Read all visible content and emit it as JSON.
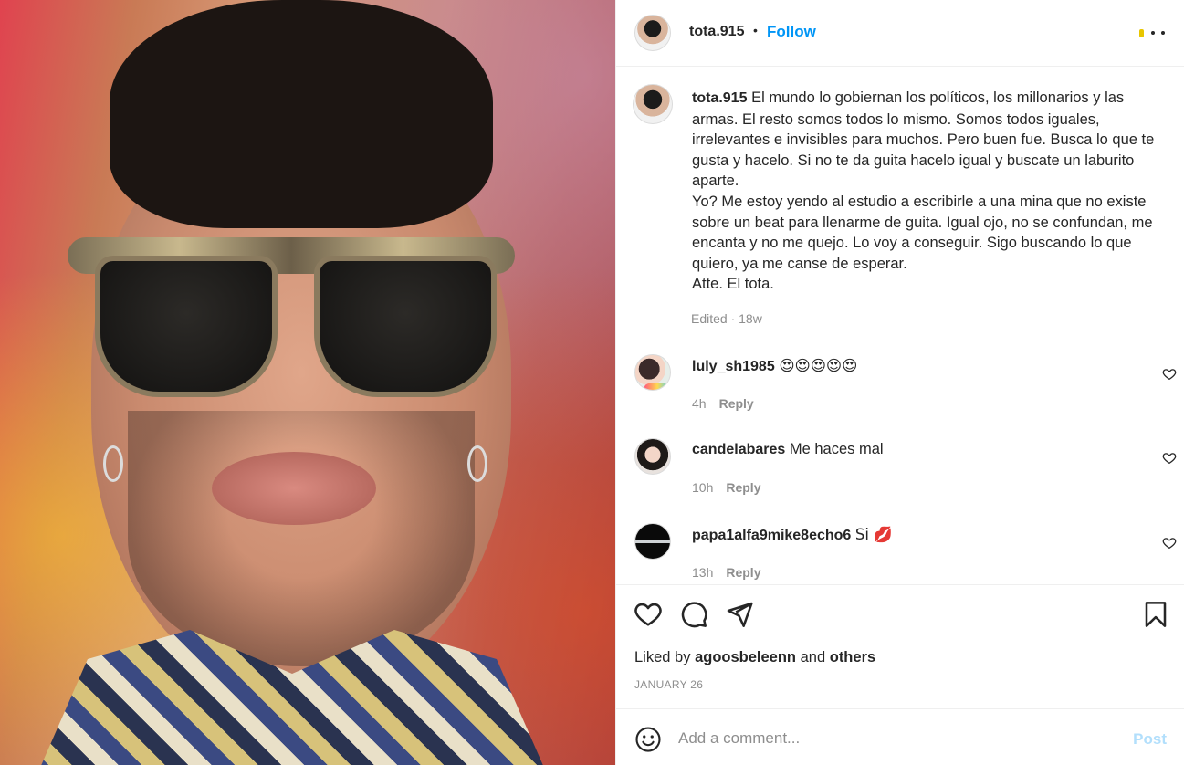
{
  "post": {
    "owner_username": "tota.915",
    "follow_label": "Follow",
    "separator": "•"
  },
  "caption": {
    "username": "tota.915",
    "text": "El mundo lo gobiernan los políticos, los millonarios y las armas. El resto somos todos lo mismo. Somos todos iguales, irrelevantes e invisibles para muchos. Pero buen fue. Busca lo que te gusta y hacelo. Si no te da guita hacelo igual y buscate un laburito aparte.\nYo? Me estoy yendo al estudio a escribirle a una mina que no existe sobre un beat para llenarme de guita. Igual ojo, no se confundan, me encanta y no me quejo. Lo voy a conseguir. Sigo buscando lo que quiero, ya me canse de esperar.\nAtte. El tota.",
    "meta": "Edited · 18w"
  },
  "comments": [
    {
      "username": "luly_sh1985",
      "text": "😍😍😍😍😍",
      "time": "4h",
      "reply_label": "Reply"
    },
    {
      "username": "candelabares",
      "text": "Me haces mal",
      "time": "10h",
      "reply_label": "Reply"
    },
    {
      "username": "papa1alfa9mike8echo6",
      "text": "Si 💋",
      "time": "13h",
      "reply_label": "Reply"
    }
  ],
  "likes": {
    "prefix": "Liked by",
    "user": "agoosbeleenn",
    "connector": "and",
    "others": "others"
  },
  "date": "JANUARY 26",
  "add_comment": {
    "placeholder": "Add a comment...",
    "post_label": "Post"
  },
  "icons": {
    "like": "heart-icon",
    "comment": "comment-bubble-icon",
    "share": "paper-plane-icon",
    "save": "bookmark-icon",
    "emoji": "smiley-icon",
    "more": "more-options-icon"
  },
  "colors": {
    "accent": "#0095f6",
    "post_disabled": "#b2dffc",
    "muted": "#8e8e8e",
    "text": "#262626"
  }
}
